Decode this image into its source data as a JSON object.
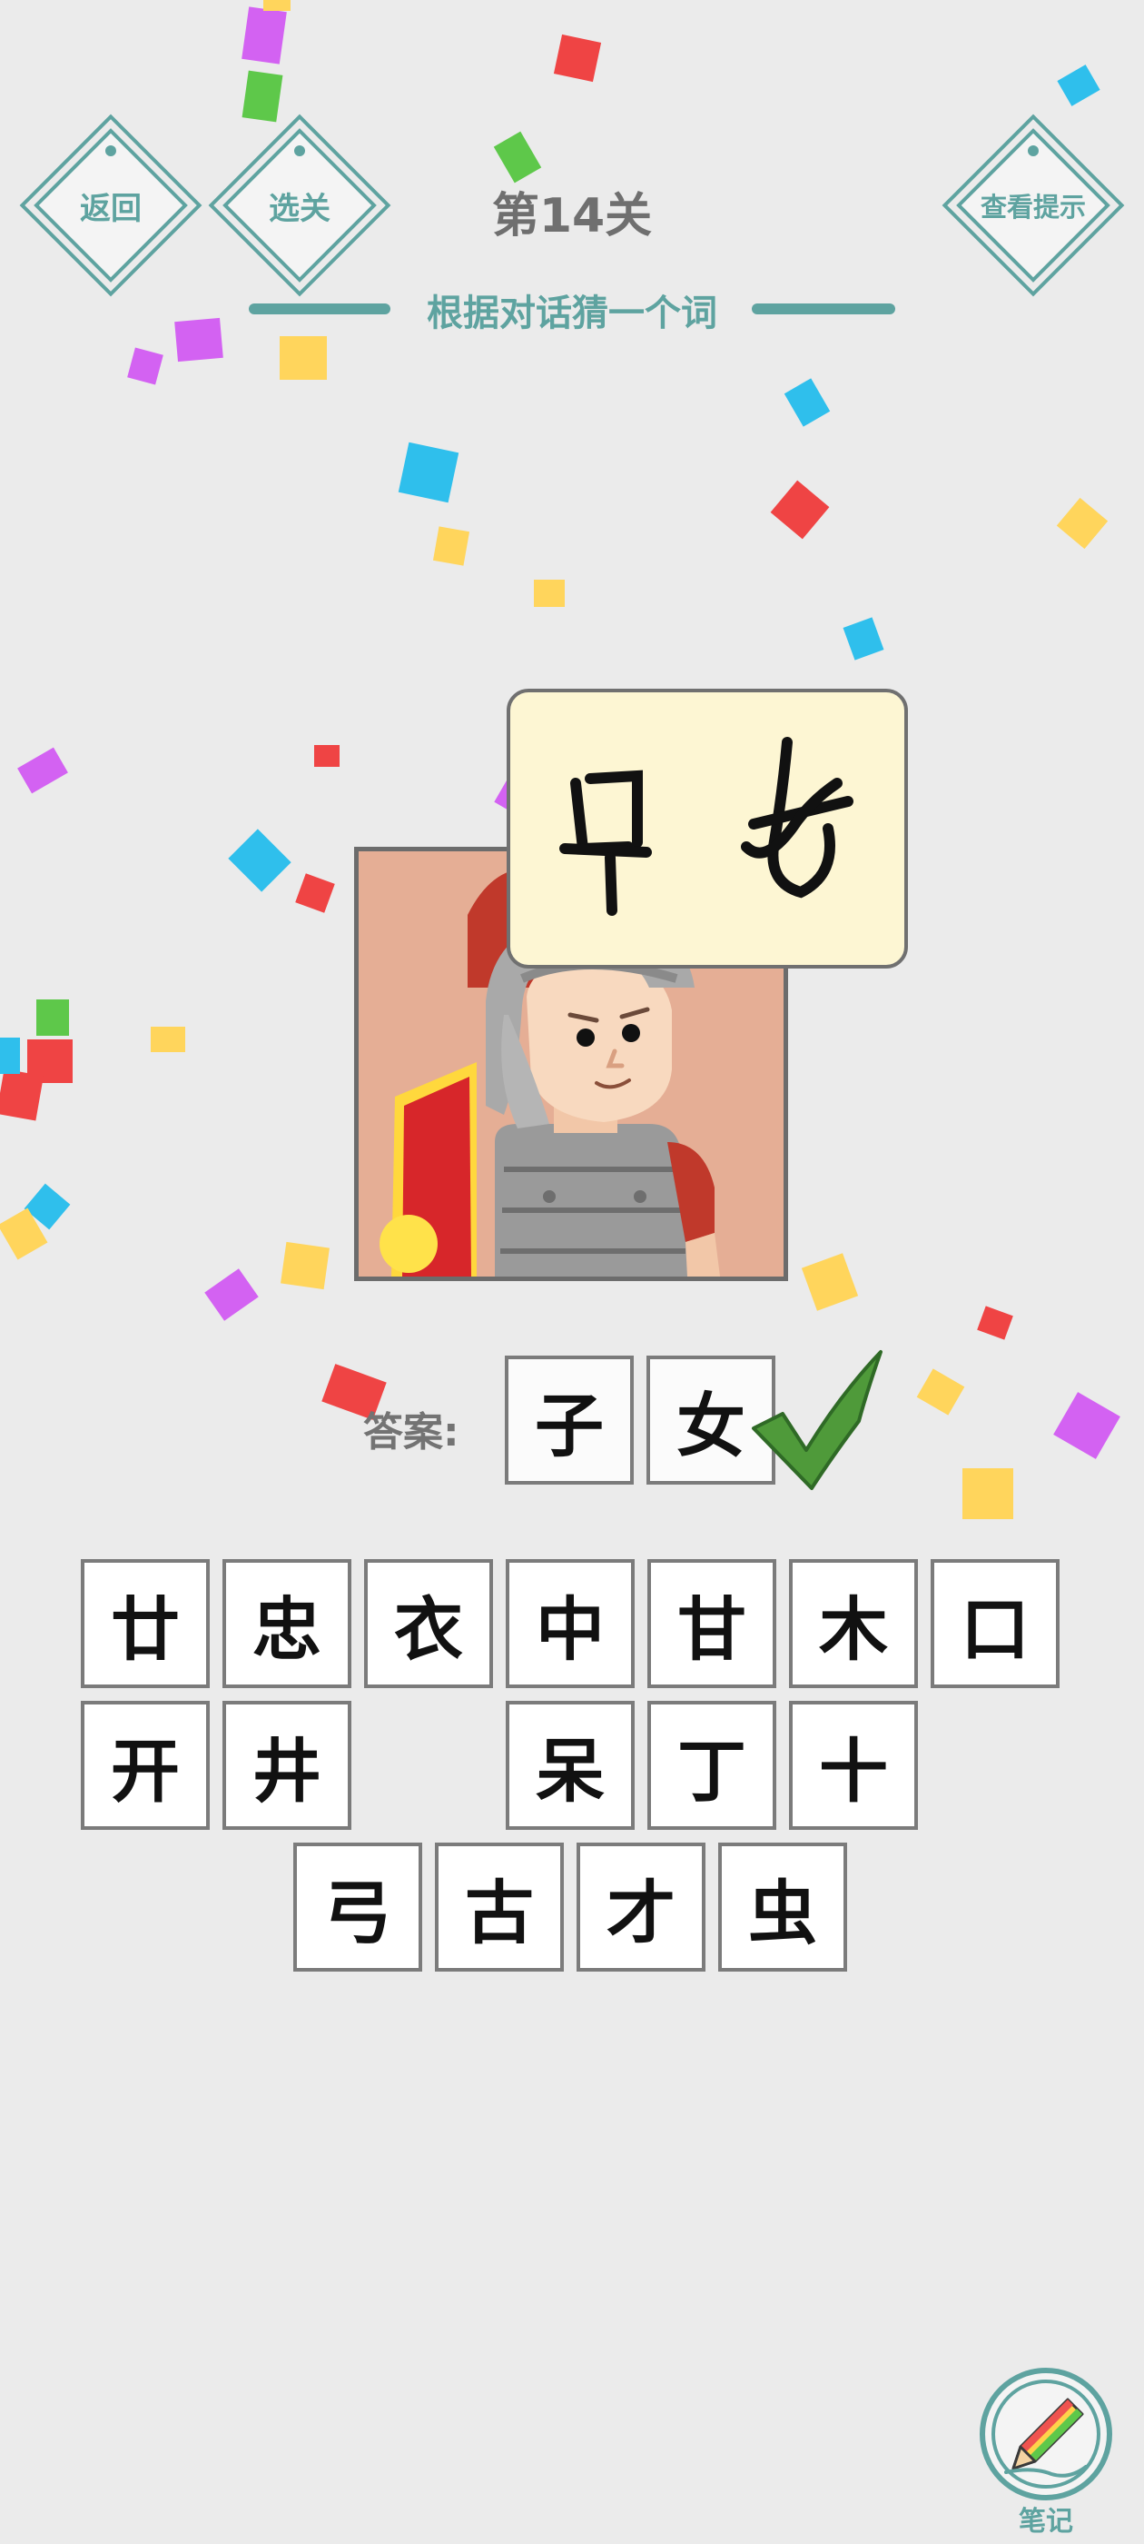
{
  "header": {
    "back_label": "返回",
    "select_label": "选关",
    "level_title": "第14关",
    "hint_label": "查看提示",
    "subtitle": "根据对话猜一个词"
  },
  "answer": {
    "label": "答案:",
    "chars": [
      "子",
      "女"
    ],
    "status": "correct"
  },
  "choices": {
    "row1": [
      "廿",
      "忠",
      "衣",
      "中",
      "甘",
      "木",
      "口"
    ],
    "row2": [
      "开",
      "井",
      "",
      "呆",
      "丁",
      "十"
    ],
    "row3": [
      "弓",
      "古",
      "才",
      "虫"
    ]
  },
  "note": {
    "label": "笔记"
  },
  "colors": {
    "accent": "#5ea3a0",
    "check": "#4f9a3a",
    "confetti": [
      "#ef4444",
      "#2fbfec",
      "#ffd55c",
      "#d362f2",
      "#5ec84a"
    ]
  }
}
